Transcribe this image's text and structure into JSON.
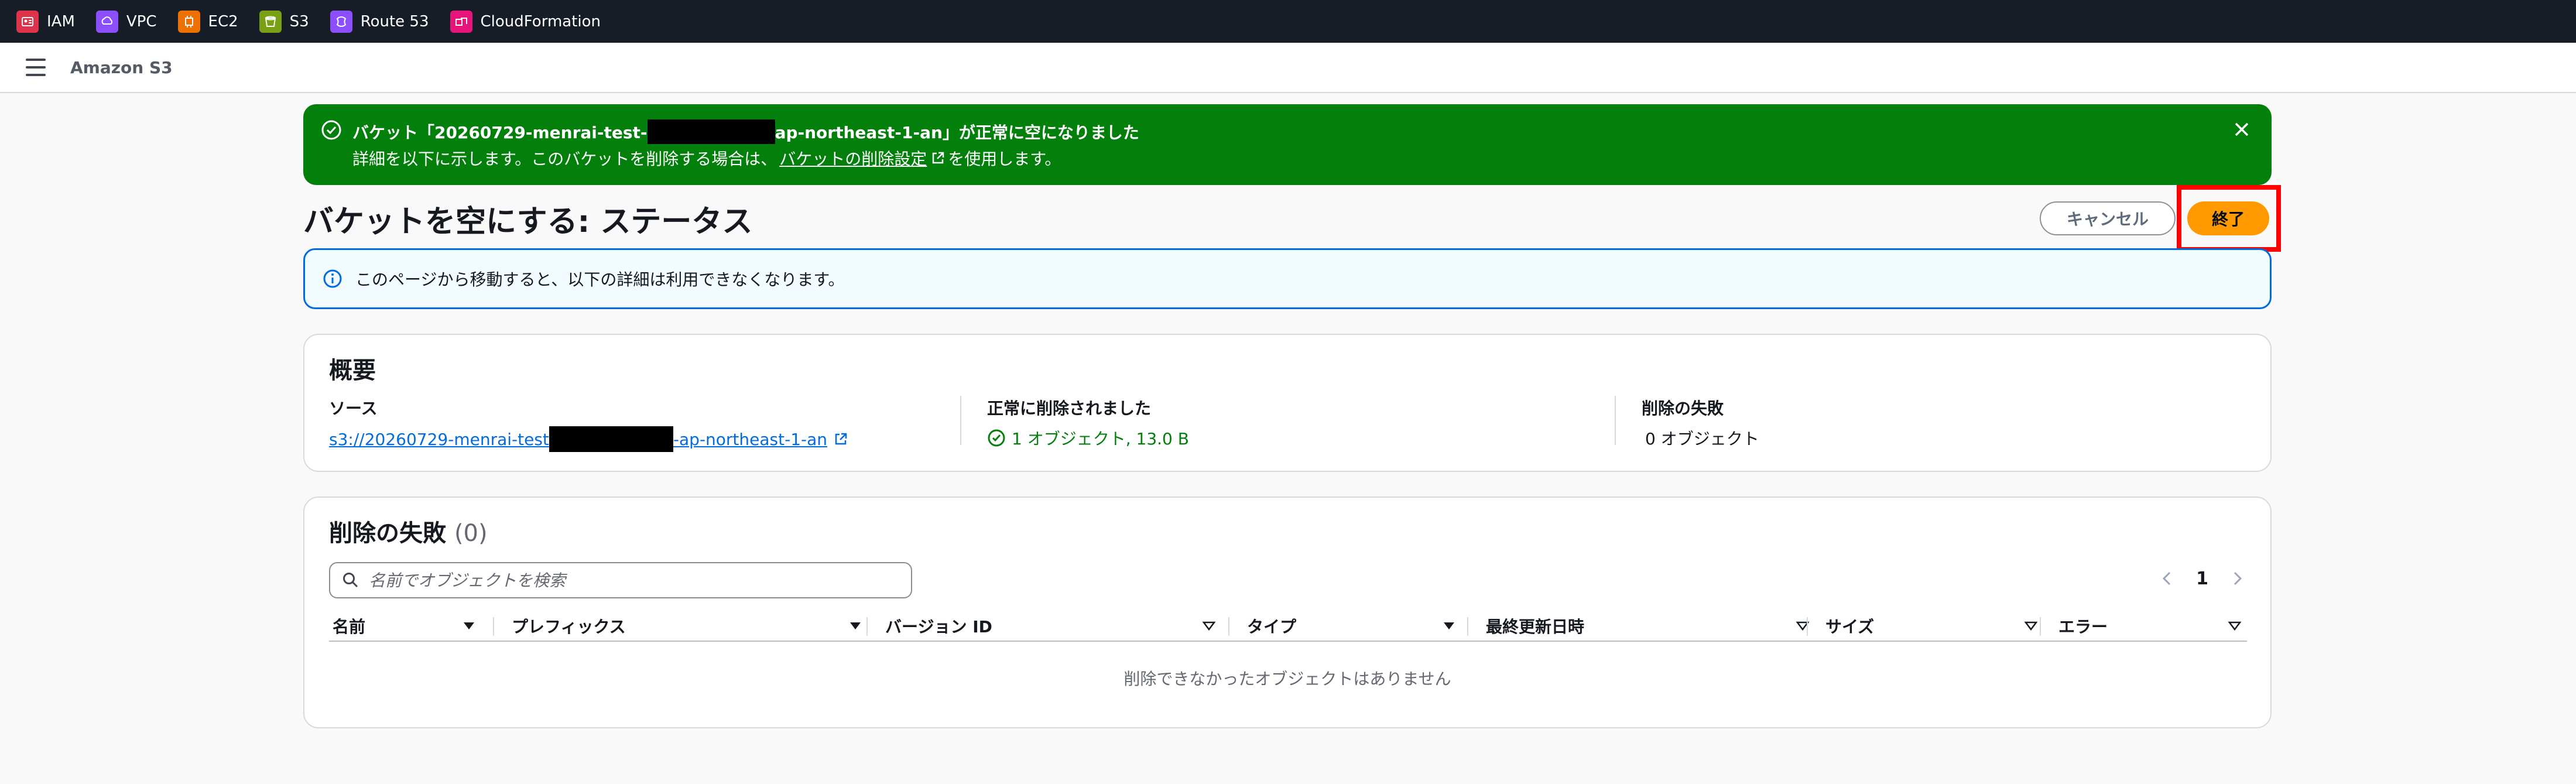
{
  "services": [
    {
      "label": "IAM",
      "icon": "iam-icon",
      "color": "#dd344c"
    },
    {
      "label": "VPC",
      "icon": "vpc-icon",
      "color": "#8c4fff"
    },
    {
      "label": "EC2",
      "icon": "ec2-icon",
      "color": "#ed7100"
    },
    {
      "label": "S3",
      "icon": "s3-icon",
      "color": "#7aa116"
    },
    {
      "label": "Route 53",
      "icon": "route53-icon",
      "color": "#8c4fff"
    },
    {
      "label": "CloudFormation",
      "icon": "cloudformation-icon",
      "color": "#e7157b"
    }
  ],
  "console": {
    "title": "Amazon S3"
  },
  "flash": {
    "title_prefix": "バケット「20260729-menrai-test-",
    "title_suffix": "ap-northeast-1-an」が正常に空になりました",
    "detail_prefix": "詳細を以下に示します。このバケットを削除する場合は、",
    "detail_link": "バケットの削除設定",
    "detail_suffix": "を使用します。",
    "color": "#037f0c"
  },
  "page": {
    "title": "バケットを空にする: ステータス",
    "cancel_label": "キャンセル",
    "finish_label": "終了"
  },
  "info": {
    "text": "このページから移動すると、以下の詳細は利用できなくなります。"
  },
  "summary": {
    "title": "概要",
    "source_label": "ソース",
    "source_prefix": "s3://20260729-menrai-test",
    "source_suffix": "-ap-northeast-1-an",
    "success_label": "正常に削除されました",
    "success_value": "1 オブジェクト, 13.0 B",
    "failed_label": "削除の失敗",
    "failed_value": "0 オブジェクト"
  },
  "failures": {
    "title": "削除の失敗",
    "count": "(0)",
    "search_placeholder": "名前でオブジェクトを検索",
    "page_number": "1",
    "columns": [
      "名前",
      "プレフィックス",
      "バージョン ID",
      "タイプ",
      "最終更新日時",
      "サイズ",
      "エラー"
    ],
    "empty_text": "削除できなかったオブジェクトはありません"
  }
}
